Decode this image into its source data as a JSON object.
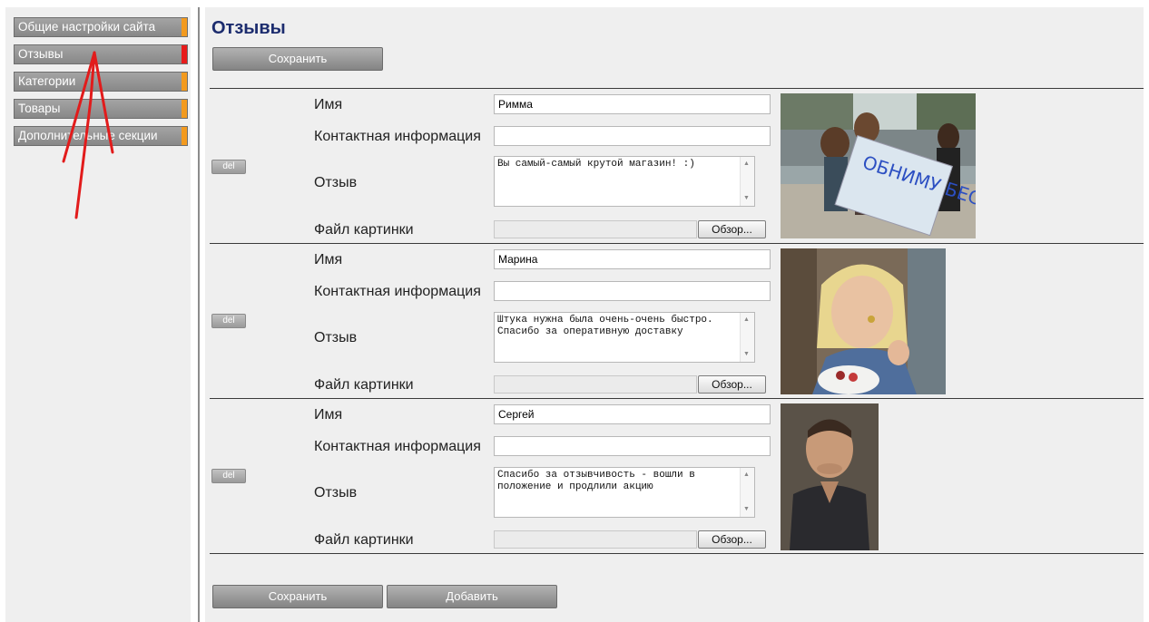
{
  "sidebar": {
    "items": [
      {
        "label": "Общие настройки сайта",
        "active": false
      },
      {
        "label": "Отзывы",
        "active": true
      },
      {
        "label": "Категории",
        "active": false
      },
      {
        "label": "Товары",
        "active": false
      },
      {
        "label": "Дополнительные секции",
        "active": false
      }
    ]
  },
  "page": {
    "title": "Отзывы",
    "save_label": "Сохранить",
    "add_label": "Добавить"
  },
  "labels": {
    "name": "Имя",
    "contact": "Контактная информация",
    "review": "Отзыв",
    "image_file": "Файл картинки",
    "browse": "Обзор...",
    "delete": "del"
  },
  "reviews": [
    {
      "name": "Римма",
      "contact": "",
      "review": "Вы самый-самый крутой магазин! :)",
      "image_text": "ОБНИМУ БЕСПЛАТНО"
    },
    {
      "name": "Марина",
      "contact": "",
      "review": "Штука нужна была очень-очень быстро. Спасибо за оперативную доставку"
    },
    {
      "name": "Сергей",
      "contact": "",
      "review": "Спасибо за отзывчивость - вошли в положение и продлили акцию"
    }
  ],
  "colors": {
    "accent_orange": "#f39a1e",
    "accent_active": "#e81b1b",
    "title": "#1c2c6e",
    "annotation_arrow": "#e21b1b"
  }
}
